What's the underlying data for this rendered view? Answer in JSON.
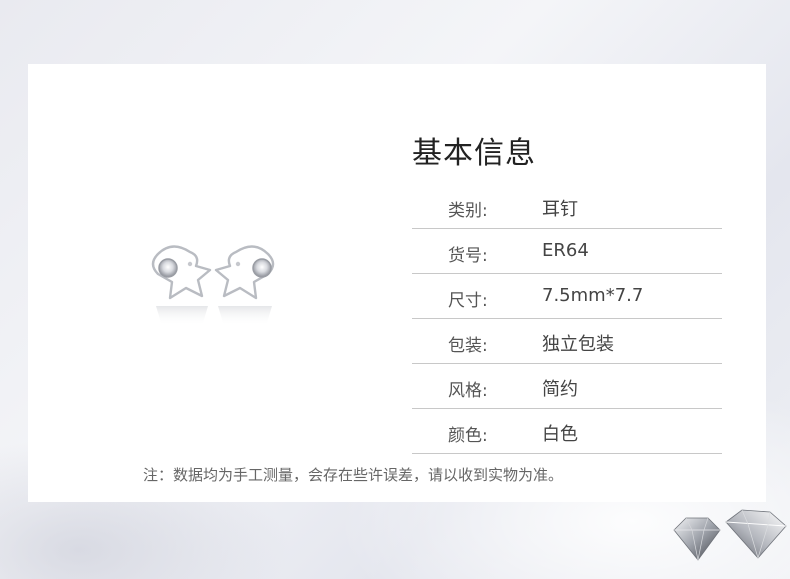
{
  "info": {
    "title": "基本信息",
    "rows": [
      {
        "label": "类别:",
        "value": "耳钉"
      },
      {
        "label": "货号:",
        "value": "ER64"
      },
      {
        "label": "尺寸:",
        "value": "7.5mm*7.7"
      },
      {
        "label": "包装:",
        "value": "独立包装"
      },
      {
        "label": "风格:",
        "value": "简约"
      },
      {
        "label": "颜色:",
        "value": "白色"
      }
    ]
  },
  "note": "注：数据均为手工测量，会存在些许误差，请以收到实物为准。",
  "icons": {
    "product": "star-stud-earrings-image",
    "decor": "diamond-gems-image"
  },
  "colors": {
    "background": "#eceef3",
    "card": "#ffffff",
    "divider": "#c8c8c8"
  }
}
